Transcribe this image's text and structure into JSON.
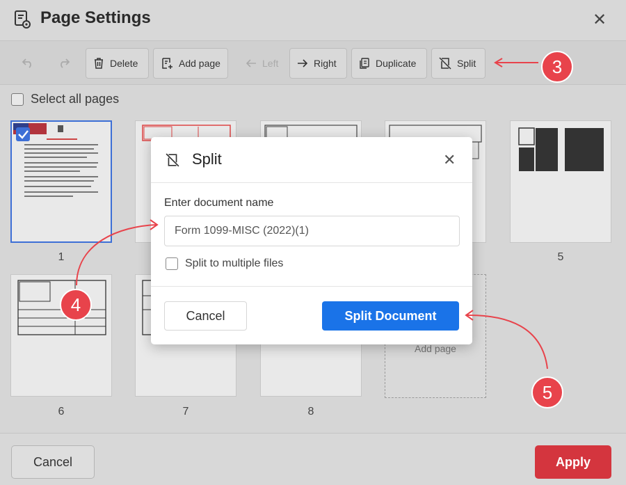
{
  "window": {
    "title": "Page Settings"
  },
  "toolbar": {
    "delete": "Delete",
    "add_page": "Add page",
    "left": "Left",
    "right": "Right",
    "duplicate": "Duplicate",
    "split": "Split"
  },
  "select_all": "Select all pages",
  "pages": [
    {
      "label": "1",
      "selected": true
    },
    {
      "label": "5"
    },
    {
      "label": "6"
    },
    {
      "label": "7"
    },
    {
      "label": "8"
    }
  ],
  "add_page_tile": "Add page",
  "dialog": {
    "title": "Split",
    "field_label": "Enter document name",
    "field_value": "Form 1099-MISC (2022)(1)",
    "checkbox_label": "Split to multiple files",
    "cancel": "Cancel",
    "confirm": "Split Document"
  },
  "footer": {
    "cancel": "Cancel",
    "apply": "Apply"
  },
  "annotations": [
    "3",
    "4",
    "5"
  ],
  "colors": {
    "accent_blue": "#1a73e8",
    "apply_red": "#d4353e",
    "badge_red": "#e8434b"
  }
}
